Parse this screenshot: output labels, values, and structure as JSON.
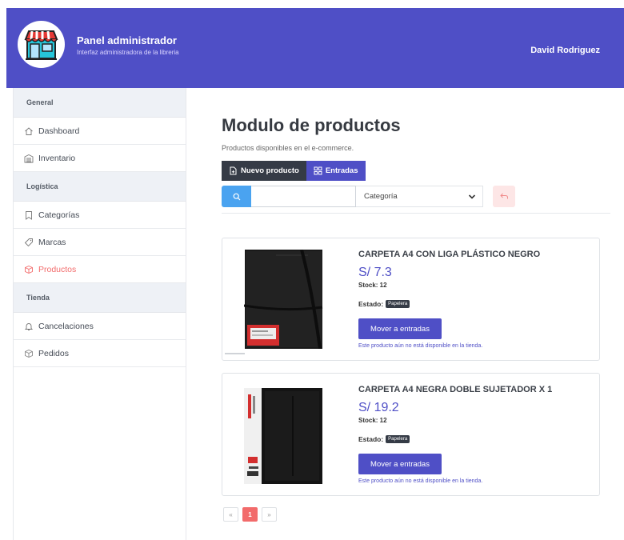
{
  "header": {
    "title": "Panel administrador",
    "subtitle": "Interfaz administradora de la libreria",
    "user": "David Rodriguez"
  },
  "sidebar": {
    "sections": [
      {
        "title": "General",
        "items": [
          {
            "label": "Dashboard",
            "icon": "home-icon"
          },
          {
            "label": "Inventario",
            "icon": "warehouse-icon"
          }
        ]
      },
      {
        "title": "Logística",
        "items": [
          {
            "label": "Categorías",
            "icon": "bookmark-icon"
          },
          {
            "label": "Marcas",
            "icon": "tag-icon"
          },
          {
            "label": "Productos",
            "icon": "box-icon",
            "active": true
          }
        ]
      },
      {
        "title": "Tienda",
        "items": [
          {
            "label": "Cancelaciones",
            "icon": "bell-icon"
          },
          {
            "label": "Pedidos",
            "icon": "package-icon"
          }
        ]
      }
    ]
  },
  "main": {
    "title": "Modulo de productos",
    "subtitle": "Productos disponibles en el e-commerce.",
    "buttons": {
      "new_product": "Nuevo producto",
      "entries": "Entradas"
    },
    "search": {
      "value": "",
      "placeholder": ""
    },
    "category_select": "Categoría",
    "products": [
      {
        "name": "CARPETA A4 CON LIGA PLÁSTICO NEGRO",
        "price": "S/ 7.3",
        "stock": "Stock: 12",
        "estado_label": "Estado:",
        "estado": "Papelera",
        "action": "Mover a entradas",
        "note": "Este producto aún no está disponible en la tienda."
      },
      {
        "name": "CARPETA A4 NEGRA DOBLE SUJETADOR X 1",
        "price": "S/ 19.2",
        "stock": "Stock: 12",
        "estado_label": "Estado:",
        "estado": "Papelera",
        "action": "Mover a entradas",
        "note": "Este producto aún no está disponible en la tienda."
      }
    ],
    "pagination": {
      "prev": "«",
      "current": "1",
      "next": "»"
    }
  },
  "colors": {
    "primary": "#4f4fc6",
    "dark": "#353b46",
    "accent_red": "#f26b6b",
    "info_blue": "#4aa3f0"
  }
}
